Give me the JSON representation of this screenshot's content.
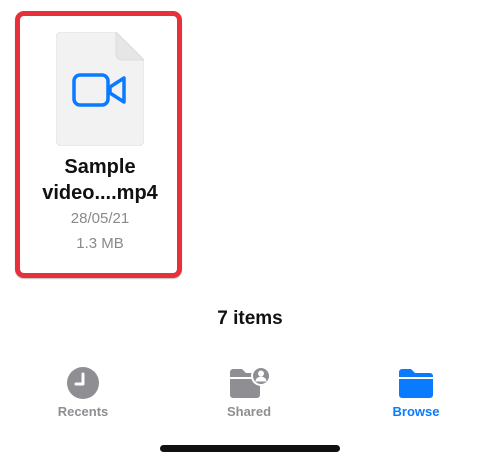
{
  "file": {
    "name_line1": "Sample",
    "name_line2": "video....mp4",
    "date": "28/05/21",
    "size": "1.3 MB",
    "icon": "video-camera-icon"
  },
  "summary": {
    "item_count": "7 items"
  },
  "tab_bar": {
    "tabs": [
      {
        "label": "Recents",
        "icon": "clock-icon",
        "active": false
      },
      {
        "label": "Shared",
        "icon": "shared-folder-icon",
        "active": false
      },
      {
        "label": "Browse",
        "icon": "folder-icon",
        "active": true
      }
    ]
  },
  "colors": {
    "highlight_border": "#e8303a",
    "accent": "#0a7aff",
    "inactive": "#8e8e93"
  }
}
